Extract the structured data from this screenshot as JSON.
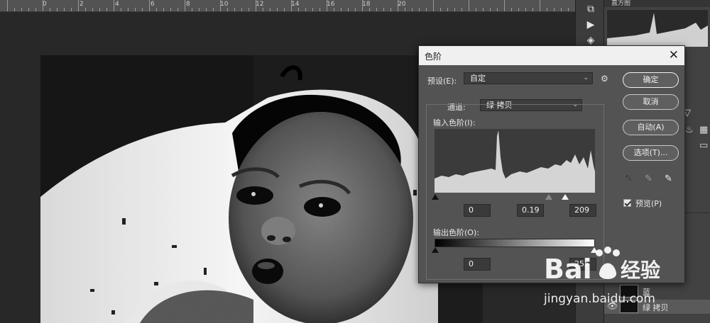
{
  "ruler": {
    "labels": [
      "0",
      "2",
      "4",
      "6",
      "8",
      "10",
      "12",
      "14",
      "16",
      "18",
      "20"
    ]
  },
  "levels_dialog": {
    "title": "色阶",
    "close_symbol": "✕",
    "preset_label": "预设(E):",
    "preset_value": "自定",
    "channel_label": "通道:",
    "channel_value": "绿 拷贝",
    "input_levels_label": "输入色阶(I):",
    "input_black": "0",
    "input_gamma": "0.19",
    "input_white": "209",
    "output_levels_label": "输出色阶(O):",
    "output_black": "0",
    "output_white": "255",
    "buttons": {
      "ok": "确定",
      "cancel": "取消",
      "auto": "自动(A)",
      "options": "选项(T)..."
    },
    "preview_label": "预览(P)",
    "preview_checked": true
  },
  "right_panel": {
    "tab_histogram": "直方图",
    "layers": [
      {
        "name": "蓝"
      },
      {
        "name": "绿 拷贝"
      }
    ]
  },
  "watermark": {
    "brand": "Bai",
    "brand_cn": "经验",
    "url": "jingyan.baidu.com"
  },
  "icons": [
    "gear-icon",
    "close-icon",
    "eyedropper-black-icon",
    "eyedropper-gray-icon",
    "eyedropper-white-icon",
    "eye-icon",
    "play-icon",
    "chevron-down-icon"
  ]
}
